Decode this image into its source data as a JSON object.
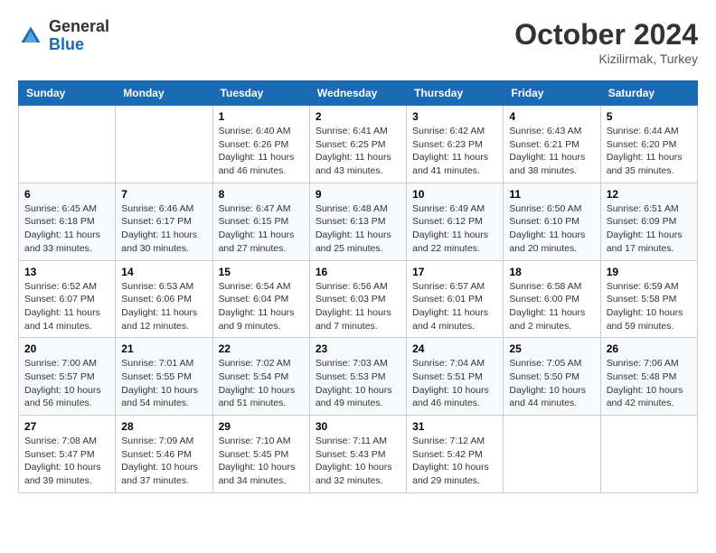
{
  "header": {
    "logo_general": "General",
    "logo_blue": "Blue",
    "month_title": "October 2024",
    "subtitle": "Kizilirmak, Turkey"
  },
  "weekdays": [
    "Sunday",
    "Monday",
    "Tuesday",
    "Wednesday",
    "Thursday",
    "Friday",
    "Saturday"
  ],
  "weeks": [
    [
      {
        "day": "",
        "sunrise": "",
        "sunset": "",
        "daylight": ""
      },
      {
        "day": "",
        "sunrise": "",
        "sunset": "",
        "daylight": ""
      },
      {
        "day": "1",
        "sunrise": "Sunrise: 6:40 AM",
        "sunset": "Sunset: 6:26 PM",
        "daylight": "Daylight: 11 hours and 46 minutes."
      },
      {
        "day": "2",
        "sunrise": "Sunrise: 6:41 AM",
        "sunset": "Sunset: 6:25 PM",
        "daylight": "Daylight: 11 hours and 43 minutes."
      },
      {
        "day": "3",
        "sunrise": "Sunrise: 6:42 AM",
        "sunset": "Sunset: 6:23 PM",
        "daylight": "Daylight: 11 hours and 41 minutes."
      },
      {
        "day": "4",
        "sunrise": "Sunrise: 6:43 AM",
        "sunset": "Sunset: 6:21 PM",
        "daylight": "Daylight: 11 hours and 38 minutes."
      },
      {
        "day": "5",
        "sunrise": "Sunrise: 6:44 AM",
        "sunset": "Sunset: 6:20 PM",
        "daylight": "Daylight: 11 hours and 35 minutes."
      }
    ],
    [
      {
        "day": "6",
        "sunrise": "Sunrise: 6:45 AM",
        "sunset": "Sunset: 6:18 PM",
        "daylight": "Daylight: 11 hours and 33 minutes."
      },
      {
        "day": "7",
        "sunrise": "Sunrise: 6:46 AM",
        "sunset": "Sunset: 6:17 PM",
        "daylight": "Daylight: 11 hours and 30 minutes."
      },
      {
        "day": "8",
        "sunrise": "Sunrise: 6:47 AM",
        "sunset": "Sunset: 6:15 PM",
        "daylight": "Daylight: 11 hours and 27 minutes."
      },
      {
        "day": "9",
        "sunrise": "Sunrise: 6:48 AM",
        "sunset": "Sunset: 6:13 PM",
        "daylight": "Daylight: 11 hours and 25 minutes."
      },
      {
        "day": "10",
        "sunrise": "Sunrise: 6:49 AM",
        "sunset": "Sunset: 6:12 PM",
        "daylight": "Daylight: 11 hours and 22 minutes."
      },
      {
        "day": "11",
        "sunrise": "Sunrise: 6:50 AM",
        "sunset": "Sunset: 6:10 PM",
        "daylight": "Daylight: 11 hours and 20 minutes."
      },
      {
        "day": "12",
        "sunrise": "Sunrise: 6:51 AM",
        "sunset": "Sunset: 6:09 PM",
        "daylight": "Daylight: 11 hours and 17 minutes."
      }
    ],
    [
      {
        "day": "13",
        "sunrise": "Sunrise: 6:52 AM",
        "sunset": "Sunset: 6:07 PM",
        "daylight": "Daylight: 11 hours and 14 minutes."
      },
      {
        "day": "14",
        "sunrise": "Sunrise: 6:53 AM",
        "sunset": "Sunset: 6:06 PM",
        "daylight": "Daylight: 11 hours and 12 minutes."
      },
      {
        "day": "15",
        "sunrise": "Sunrise: 6:54 AM",
        "sunset": "Sunset: 6:04 PM",
        "daylight": "Daylight: 11 hours and 9 minutes."
      },
      {
        "day": "16",
        "sunrise": "Sunrise: 6:56 AM",
        "sunset": "Sunset: 6:03 PM",
        "daylight": "Daylight: 11 hours and 7 minutes."
      },
      {
        "day": "17",
        "sunrise": "Sunrise: 6:57 AM",
        "sunset": "Sunset: 6:01 PM",
        "daylight": "Daylight: 11 hours and 4 minutes."
      },
      {
        "day": "18",
        "sunrise": "Sunrise: 6:58 AM",
        "sunset": "Sunset: 6:00 PM",
        "daylight": "Daylight: 11 hours and 2 minutes."
      },
      {
        "day": "19",
        "sunrise": "Sunrise: 6:59 AM",
        "sunset": "Sunset: 5:58 PM",
        "daylight": "Daylight: 10 hours and 59 minutes."
      }
    ],
    [
      {
        "day": "20",
        "sunrise": "Sunrise: 7:00 AM",
        "sunset": "Sunset: 5:57 PM",
        "daylight": "Daylight: 10 hours and 56 minutes."
      },
      {
        "day": "21",
        "sunrise": "Sunrise: 7:01 AM",
        "sunset": "Sunset: 5:55 PM",
        "daylight": "Daylight: 10 hours and 54 minutes."
      },
      {
        "day": "22",
        "sunrise": "Sunrise: 7:02 AM",
        "sunset": "Sunset: 5:54 PM",
        "daylight": "Daylight: 10 hours and 51 minutes."
      },
      {
        "day": "23",
        "sunrise": "Sunrise: 7:03 AM",
        "sunset": "Sunset: 5:53 PM",
        "daylight": "Daylight: 10 hours and 49 minutes."
      },
      {
        "day": "24",
        "sunrise": "Sunrise: 7:04 AM",
        "sunset": "Sunset: 5:51 PM",
        "daylight": "Daylight: 10 hours and 46 minutes."
      },
      {
        "day": "25",
        "sunrise": "Sunrise: 7:05 AM",
        "sunset": "Sunset: 5:50 PM",
        "daylight": "Daylight: 10 hours and 44 minutes."
      },
      {
        "day": "26",
        "sunrise": "Sunrise: 7:06 AM",
        "sunset": "Sunset: 5:48 PM",
        "daylight": "Daylight: 10 hours and 42 minutes."
      }
    ],
    [
      {
        "day": "27",
        "sunrise": "Sunrise: 7:08 AM",
        "sunset": "Sunset: 5:47 PM",
        "daylight": "Daylight: 10 hours and 39 minutes."
      },
      {
        "day": "28",
        "sunrise": "Sunrise: 7:09 AM",
        "sunset": "Sunset: 5:46 PM",
        "daylight": "Daylight: 10 hours and 37 minutes."
      },
      {
        "day": "29",
        "sunrise": "Sunrise: 7:10 AM",
        "sunset": "Sunset: 5:45 PM",
        "daylight": "Daylight: 10 hours and 34 minutes."
      },
      {
        "day": "30",
        "sunrise": "Sunrise: 7:11 AM",
        "sunset": "Sunset: 5:43 PM",
        "daylight": "Daylight: 10 hours and 32 minutes."
      },
      {
        "day": "31",
        "sunrise": "Sunrise: 7:12 AM",
        "sunset": "Sunset: 5:42 PM",
        "daylight": "Daylight: 10 hours and 29 minutes."
      },
      {
        "day": "",
        "sunrise": "",
        "sunset": "",
        "daylight": ""
      },
      {
        "day": "",
        "sunrise": "",
        "sunset": "",
        "daylight": ""
      }
    ]
  ]
}
